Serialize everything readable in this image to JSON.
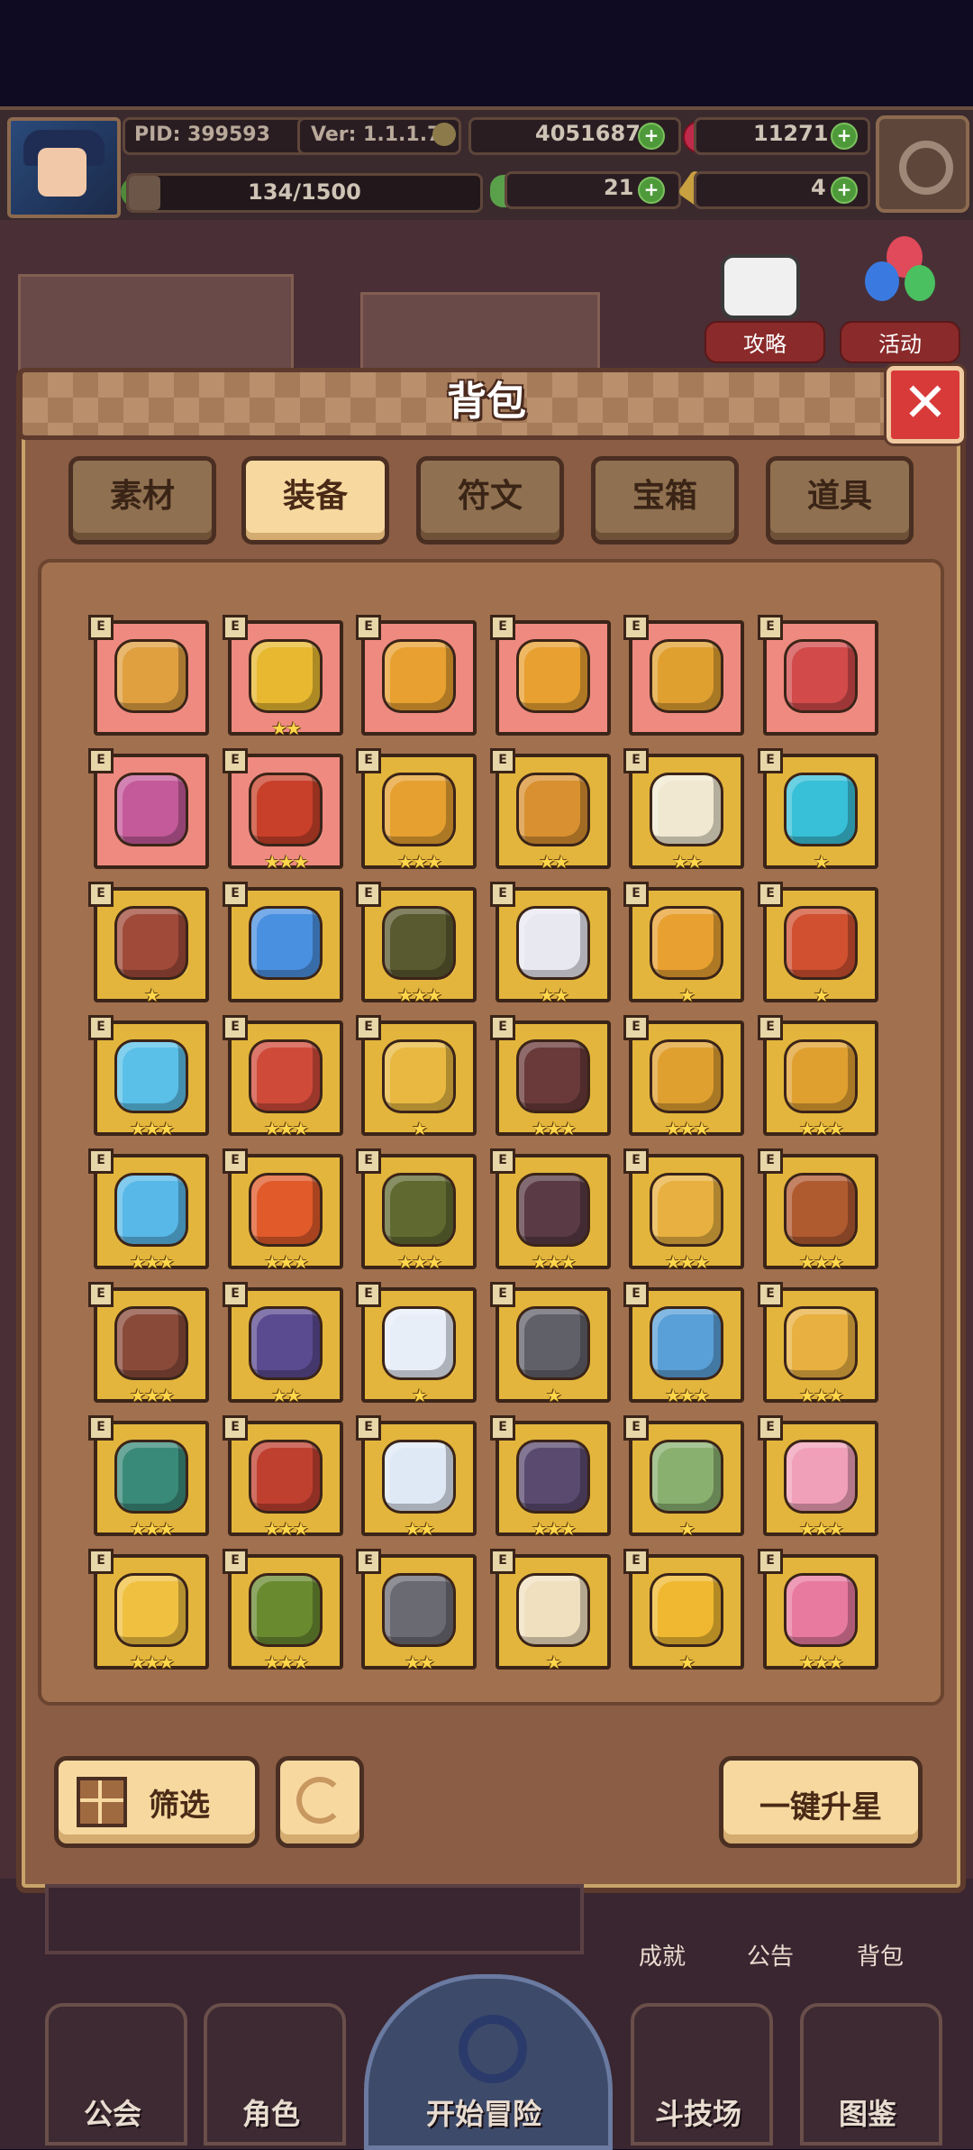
{
  "hud": {
    "pid": "PID: 399593",
    "version": "Ver: 1.1.1.7",
    "gold": "4051687",
    "gems": "11271",
    "energy": "134/1500",
    "energy_progress": 0.0893,
    "clover": "21",
    "keys": "4"
  },
  "side": {
    "guide_label": "攻略",
    "event_label": "活动"
  },
  "bag": {
    "title": "背包",
    "tabs": [
      "素材",
      "装备",
      "符文",
      "宝箱",
      "道具"
    ],
    "active_tab": "装备",
    "items": [
      {
        "bg": "pink",
        "stars": 0,
        "icon": "wand-icon",
        "color": "#e1a040"
      },
      {
        "bg": "pink",
        "stars": 2,
        "icon": "straw-hat-icon",
        "color": "#e8b830"
      },
      {
        "bg": "pink",
        "stars": 0,
        "icon": "heart-necklace-icon",
        "color": "#e8a030"
      },
      {
        "bg": "pink",
        "stars": 0,
        "icon": "ring-icon",
        "color": "#e8a030"
      },
      {
        "bg": "pink",
        "stars": 0,
        "icon": "horned-helm-icon",
        "color": "#e0a030"
      },
      {
        "bg": "pink",
        "stars": 0,
        "icon": "red-robe-icon",
        "color": "#d24a4a"
      },
      {
        "bg": "pink",
        "stars": 0,
        "icon": "purple-vest-icon",
        "color": "#c45a9a"
      },
      {
        "bg": "pink",
        "stars": 3,
        "icon": "red-pot-icon",
        "color": "#c8402a"
      },
      {
        "bg": "gold",
        "stars": 3,
        "icon": "mace-icon",
        "color": "#e6a030"
      },
      {
        "bg": "gold",
        "stars": 2,
        "icon": "scepter-icon",
        "color": "#d89030"
      },
      {
        "bg": "gold",
        "stars": 2,
        "icon": "crystal-shield-icon",
        "color": "#f0e8d0"
      },
      {
        "bg": "gold",
        "stars": 1,
        "icon": "ice-shield-icon",
        "color": "#38c0d8"
      },
      {
        "bg": "gold",
        "stars": 1,
        "icon": "fur-armor-icon",
        "color": "#a04a3a"
      },
      {
        "bg": "gold",
        "stars": 0,
        "icon": "magic-lamp-icon",
        "color": "#4a90e0"
      },
      {
        "bg": "gold",
        "stars": 3,
        "icon": "dark-mask-icon",
        "color": "#5a5a30"
      },
      {
        "bg": "gold",
        "stars": 2,
        "icon": "demon-horns-icon",
        "color": "#e8e8f0"
      },
      {
        "bg": "gold",
        "stars": 1,
        "icon": "gold-crown-icon",
        "color": "#e8a030"
      },
      {
        "bg": "gold",
        "stars": 1,
        "icon": "ruby-helm-icon",
        "color": "#d05030"
      },
      {
        "bg": "gold",
        "stars": 3,
        "icon": "ice-armor-icon",
        "color": "#5ac0e8"
      },
      {
        "bg": "gold",
        "stars": 3,
        "icon": "royal-robe-icon",
        "color": "#d04a3a"
      },
      {
        "bg": "gold",
        "stars": 1,
        "icon": "gold-armor-icon",
        "color": "#e8b840"
      },
      {
        "bg": "gold",
        "stars": 3,
        "icon": "dark-armor-icon",
        "color": "#6a3a3a"
      },
      {
        "bg": "gold",
        "stars": 3,
        "icon": "gold-gauntlet-icon",
        "color": "#e0a030"
      },
      {
        "bg": "gold",
        "stars": 3,
        "icon": "war-horn-icon",
        "color": "#e0a030"
      },
      {
        "bg": "gold",
        "stars": 3,
        "icon": "ice-glove-icon",
        "color": "#58b8e8"
      },
      {
        "bg": "gold",
        "stars": 3,
        "icon": "fire-glove-icon",
        "color": "#e05a2a"
      },
      {
        "bg": "gold",
        "stars": 3,
        "icon": "green-gauntlet-icon",
        "color": "#606a30"
      },
      {
        "bg": "gold",
        "stars": 3,
        "icon": "demon-gauntlet-icon",
        "color": "#5a3a44"
      },
      {
        "bg": "gold",
        "stars": 3,
        "icon": "ruby-ring-icon",
        "color": "#e8b040"
      },
      {
        "bg": "gold",
        "stars": 3,
        "icon": "emerald-ring-icon",
        "color": "#b05a30"
      },
      {
        "bg": "gold",
        "stars": 3,
        "icon": "brown-belt-icon",
        "color": "#8a4a3a"
      },
      {
        "bg": "gold",
        "stars": 2,
        "icon": "purple-belt-icon",
        "color": "#5a4a90"
      },
      {
        "bg": "gold",
        "stars": 1,
        "icon": "white-belt-icon",
        "color": "#e8eef8"
      },
      {
        "bg": "gold",
        "stars": 1,
        "icon": "iron-belt-icon",
        "color": "#606068"
      },
      {
        "bg": "gold",
        "stars": 3,
        "icon": "sapphire-belt-icon",
        "color": "#5aa0d8"
      },
      {
        "bg": "gold",
        "stars": 3,
        "icon": "gold-boots-icon",
        "color": "#e8b040"
      },
      {
        "bg": "gold",
        "stars": 3,
        "icon": "teal-boots-icon",
        "color": "#3a8a7a"
      },
      {
        "bg": "gold",
        "stars": 3,
        "icon": "red-boots-icon",
        "color": "#c04030"
      },
      {
        "bg": "gold",
        "stars": 2,
        "icon": "white-boots-icon",
        "color": "#dfe8f5"
      },
      {
        "bg": "gold",
        "stars": 3,
        "icon": "shadow-boots-icon",
        "color": "#5a4a70"
      },
      {
        "bg": "gold",
        "stars": 1,
        "icon": "jade-boots-icon",
        "color": "#8ab070"
      },
      {
        "bg": "gold",
        "stars": 3,
        "icon": "heart-amulet-icon",
        "color": "#f0a0b8"
      },
      {
        "bg": "gold",
        "stars": 3,
        "icon": "gold-amulet-icon",
        "color": "#f0c040"
      },
      {
        "bg": "gold",
        "stars": 3,
        "icon": "leaf-amulet-icon",
        "color": "#6a8a30"
      },
      {
        "bg": "gold",
        "stars": 2,
        "icon": "stone-amulet-icon",
        "color": "#6a6a72"
      },
      {
        "bg": "gold",
        "stars": 1,
        "icon": "wing-amulet-icon",
        "color": "#f0e0c0"
      },
      {
        "bg": "gold",
        "stars": 1,
        "icon": "star-amulet-icon",
        "color": "#f0b830"
      },
      {
        "bg": "gold",
        "stars": 3,
        "icon": "heart-pendant-icon",
        "color": "#e87aa0"
      }
    ],
    "filter_label": "筛选",
    "upgrade_all_label": "一键升星"
  },
  "under_panel": {
    "achievements_label": "成就",
    "notice_label": "公告",
    "bag_label": "背包"
  },
  "nav": {
    "guild": "公会",
    "character": "角色",
    "adventure": "开始冒险",
    "arena": "斗技场",
    "codex": "图鉴"
  },
  "colors": {
    "pink_cell": "#ee8a80",
    "gold_cell": "#e3b53c",
    "tab_active": "#f7d9a0",
    "close_red": "#d83a3a"
  }
}
